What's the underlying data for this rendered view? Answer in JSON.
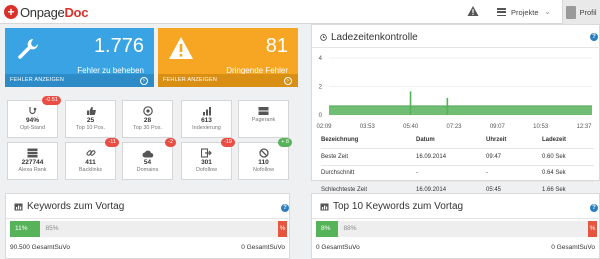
{
  "brand": {
    "part1": "Onpage",
    "part2": "Doc"
  },
  "topbar": {
    "projects_label": "Projekte",
    "profile_label": "Profil"
  },
  "tiles": [
    {
      "value": "1.776",
      "label": "Fehler zu beheben",
      "footer": "FEHLER ANZEIGEN",
      "icon": "wrench-icon",
      "color": "#3aa3e3"
    },
    {
      "value": "81",
      "label": "Dringende Fehler",
      "footer": "FEHLER ANZEIGEN",
      "icon": "warning-icon",
      "color": "#f6a623"
    }
  ],
  "metrics": [
    {
      "value": "94%",
      "label": "Opt-Stand",
      "badge": "-0.51",
      "badge_color": "red",
      "icon": "stethoscope-icon"
    },
    {
      "value": "25",
      "label": "Top 10 Pos.",
      "icon": "thumbs-up-icon"
    },
    {
      "value": "28",
      "label": "Top 30 Pos.",
      "icon": "target-icon"
    },
    {
      "value": "613",
      "label": "Indexierung",
      "icon": "bar-chart-icon"
    },
    {
      "value": "",
      "label": "Pagerank",
      "icon": "server-icon"
    },
    {
      "value": "227744",
      "label": "Alexa Rank",
      "icon": "server-stack-icon"
    },
    {
      "value": "411",
      "label": "Backlinks",
      "badge": "-11",
      "badge_color": "red",
      "icon": "link-icon"
    },
    {
      "value": "54",
      "label": "Domains",
      "badge": "-2",
      "badge_color": "red",
      "icon": "cloud-icon"
    },
    {
      "value": "301",
      "label": "Dofollow",
      "badge": "-19",
      "badge_color": "red",
      "icon": "follow-arrow-icon"
    },
    {
      "value": "110",
      "label": "Nofollow",
      "badge": "+ 8",
      "badge_color": "green",
      "icon": "no-icon"
    }
  ],
  "ladezeiten": {
    "title": "Ladezeitenkontrolle",
    "headers": [
      "Bezeichnung",
      "Datum",
      "Uhrzeit",
      "Ladezeit"
    ],
    "rows": [
      [
        "Beste Zeit",
        "16.09.2014",
        "09:47",
        "0.60 Sek"
      ],
      [
        "Durchschnitt",
        "-",
        "-",
        "0.64 Sek"
      ],
      [
        "Schlechteste Zeit",
        "16.09.2014",
        "05:45",
        "1.66 Sek"
      ]
    ]
  },
  "chart_data": {
    "type": "bar",
    "yticks": [
      "0",
      "2",
      "4"
    ],
    "xticks": [
      "02:09",
      "03:53",
      "05:40",
      "07:23",
      "09:07",
      "10:53",
      "12:37"
    ],
    "ylim": [
      0,
      4
    ],
    "baseline": 0.64,
    "spikes": [
      {
        "position": 0.31,
        "value": 1.66
      },
      {
        "position": 0.45,
        "value": 1.2
      }
    ],
    "color": "#57b35a",
    "grid": true
  },
  "kw_vortag": {
    "title": "Keywords zum Vortag",
    "green_pct": "11%",
    "grey_pct": "85%",
    "red_pct": "%",
    "green_fraction": 0.11,
    "left_label": "90.500 GesamtSuVo",
    "right_label": "0 GesamtSuVo"
  },
  "kw_top10": {
    "title": "Top 10 Keywords zum Vortag",
    "green_pct": "8%",
    "grey_pct": "88%",
    "red_pct": "%",
    "green_fraction": 0.08,
    "left_label": "0 GesamtSuVo",
    "right_label": "0 GesamtSuVo"
  }
}
